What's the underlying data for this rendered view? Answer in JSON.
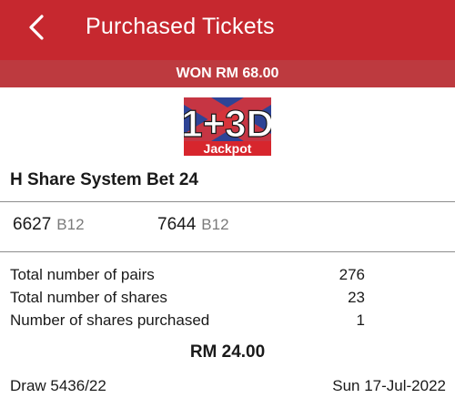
{
  "header": {
    "title": "Purchased Tickets",
    "back_icon": "chevron-left-icon",
    "bg_color": "#c6282f"
  },
  "won_banner": {
    "text": "WON RM 68.00",
    "bg_color": "#bd3a3f"
  },
  "logo": {
    "text_main": "1+3D",
    "text_sub": "Jackpot"
  },
  "bet": {
    "title": "H Share System Bet 24"
  },
  "numbers": [
    {
      "number": "6627",
      "code": "B12"
    },
    {
      "number": "7644",
      "code": "B12"
    }
  ],
  "stats": [
    {
      "label": "Total number of pairs",
      "value": "276"
    },
    {
      "label": "Total number of shares",
      "value": "23"
    },
    {
      "label": "Number of shares purchased",
      "value": "1"
    }
  ],
  "amount": "RM 24.00",
  "draw": {
    "label": "Draw 5436/22",
    "date": "Sun 17-Jul-2022"
  }
}
